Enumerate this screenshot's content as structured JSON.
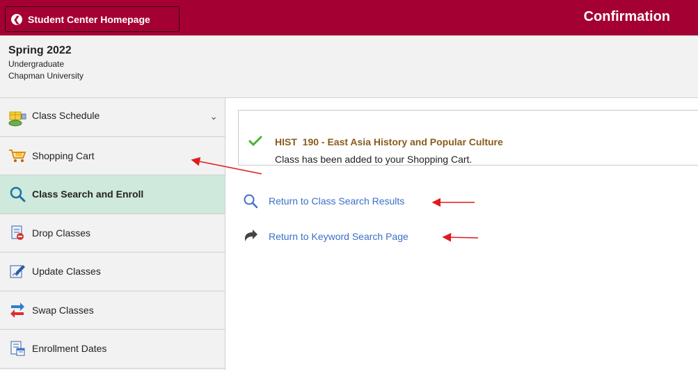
{
  "header": {
    "back_label": "Student Center Homepage",
    "page_title": "Confirmation"
  },
  "term": {
    "name": "Spring 2022",
    "career": "Undergraduate",
    "institution": "Chapman University"
  },
  "sidebar": {
    "items": [
      {
        "label": "Class Schedule",
        "icon": "class-schedule-icon"
      },
      {
        "label": "Shopping Cart",
        "icon": "shopping-cart-icon"
      },
      {
        "label": "Class Search and Enroll",
        "icon": "search-icon",
        "active": true
      },
      {
        "label": "Drop Classes",
        "icon": "drop-classes-icon"
      },
      {
        "label": "Update Classes",
        "icon": "update-classes-icon"
      },
      {
        "label": "Swap Classes",
        "icon": "swap-classes-icon"
      },
      {
        "label": "Enrollment Dates",
        "icon": "enrollment-dates-icon"
      }
    ]
  },
  "confirmation": {
    "class_title": "HIST  190 - East Asia History and Popular Culture",
    "message": "Class has been added to your Shopping Cart."
  },
  "links": {
    "class_search_results": "Return to Class Search Results",
    "keyword_search": "Return to Keyword Search Page"
  },
  "colors": {
    "brand": "#a50034",
    "active_nav": "#cfe9dc",
    "link": "#3a6fcb",
    "class_title": "#8b5a1b",
    "annotation_arrow": "#e01b1b"
  }
}
